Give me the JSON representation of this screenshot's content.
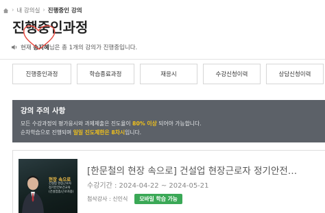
{
  "breadcrumb": {
    "home_icon": "home-icon",
    "items": [
      "내 강의실",
      "진행중인 강의"
    ]
  },
  "page": {
    "title": "진행중인과정"
  },
  "notice": {
    "icon": "speaker-icon",
    "prefix": "현재",
    "username": "송지혜",
    "suffix": "님은 총 1개의 강의가 진행중입니다."
  },
  "tabs": [
    {
      "label": "진행중인과정"
    },
    {
      "label": "학습종료과정"
    },
    {
      "label": "재응시"
    },
    {
      "label": "수강신청이력"
    },
    {
      "label": "상담신청이력"
    }
  ],
  "warning": {
    "title": "강의 주의 사항",
    "line1_a": "모든 수강과정의 평가응시와 과제제출은 진도율이",
    "line1_hl": "80% 이상",
    "line1_b": "되어야 가능합니다.",
    "line2_a": "순차학습으로 진행되며",
    "line2_hl": "일일 진도제한은 8차시",
    "line2_b": "입니다.",
    "highlight_color": "#f2c21b"
  },
  "course": {
    "title": "[한문철의 현장 속으로] 건설업 현장근로자 정기안전…",
    "period_label": "수강기간 :",
    "period": "2024-04-22 ~ 2024-05-21",
    "teacher_label": "첨삭강사 :",
    "teacher": "신인식",
    "badge": "모바일 학습 가능",
    "badge_color": "#3aa856",
    "thumbnail": {
      "brand": "",
      "headline": "현장 속으로",
      "sub": [
        "건설업 현장근로자",
        "정기안전보건교육",
        "(건설업종/근로자용)"
      ]
    }
  }
}
